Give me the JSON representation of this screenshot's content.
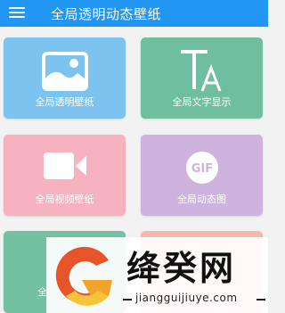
{
  "app": {
    "title": "全局透明动态壁纸",
    "menu_icon": "hamburger-menu-icon"
  },
  "colors": {
    "appbar": "#2196f3",
    "card1": "#7dc3f0",
    "card2": "#6fbe9f",
    "card3": "#f6b3bf",
    "card4": "#cdb3de",
    "card5": "#74c0a2",
    "card6": "#f4b8ad"
  },
  "cards": [
    {
      "label": "全局透明壁纸",
      "icon": "image-icon"
    },
    {
      "label": "全局文字显示",
      "icon": "text-icon"
    },
    {
      "label": "全局视频壁纸",
      "icon": "video-camera-icon"
    },
    {
      "label": "全局动态图",
      "icon": "gif-icon"
    },
    {
      "label": "全",
      "icon": ""
    },
    {
      "label": "",
      "icon": ""
    }
  ],
  "icon_text": {
    "text_icon": "TA",
    "gif": "GIF"
  },
  "watermark": {
    "name": "绛癸网",
    "url": "jiangguijiuye.com"
  }
}
